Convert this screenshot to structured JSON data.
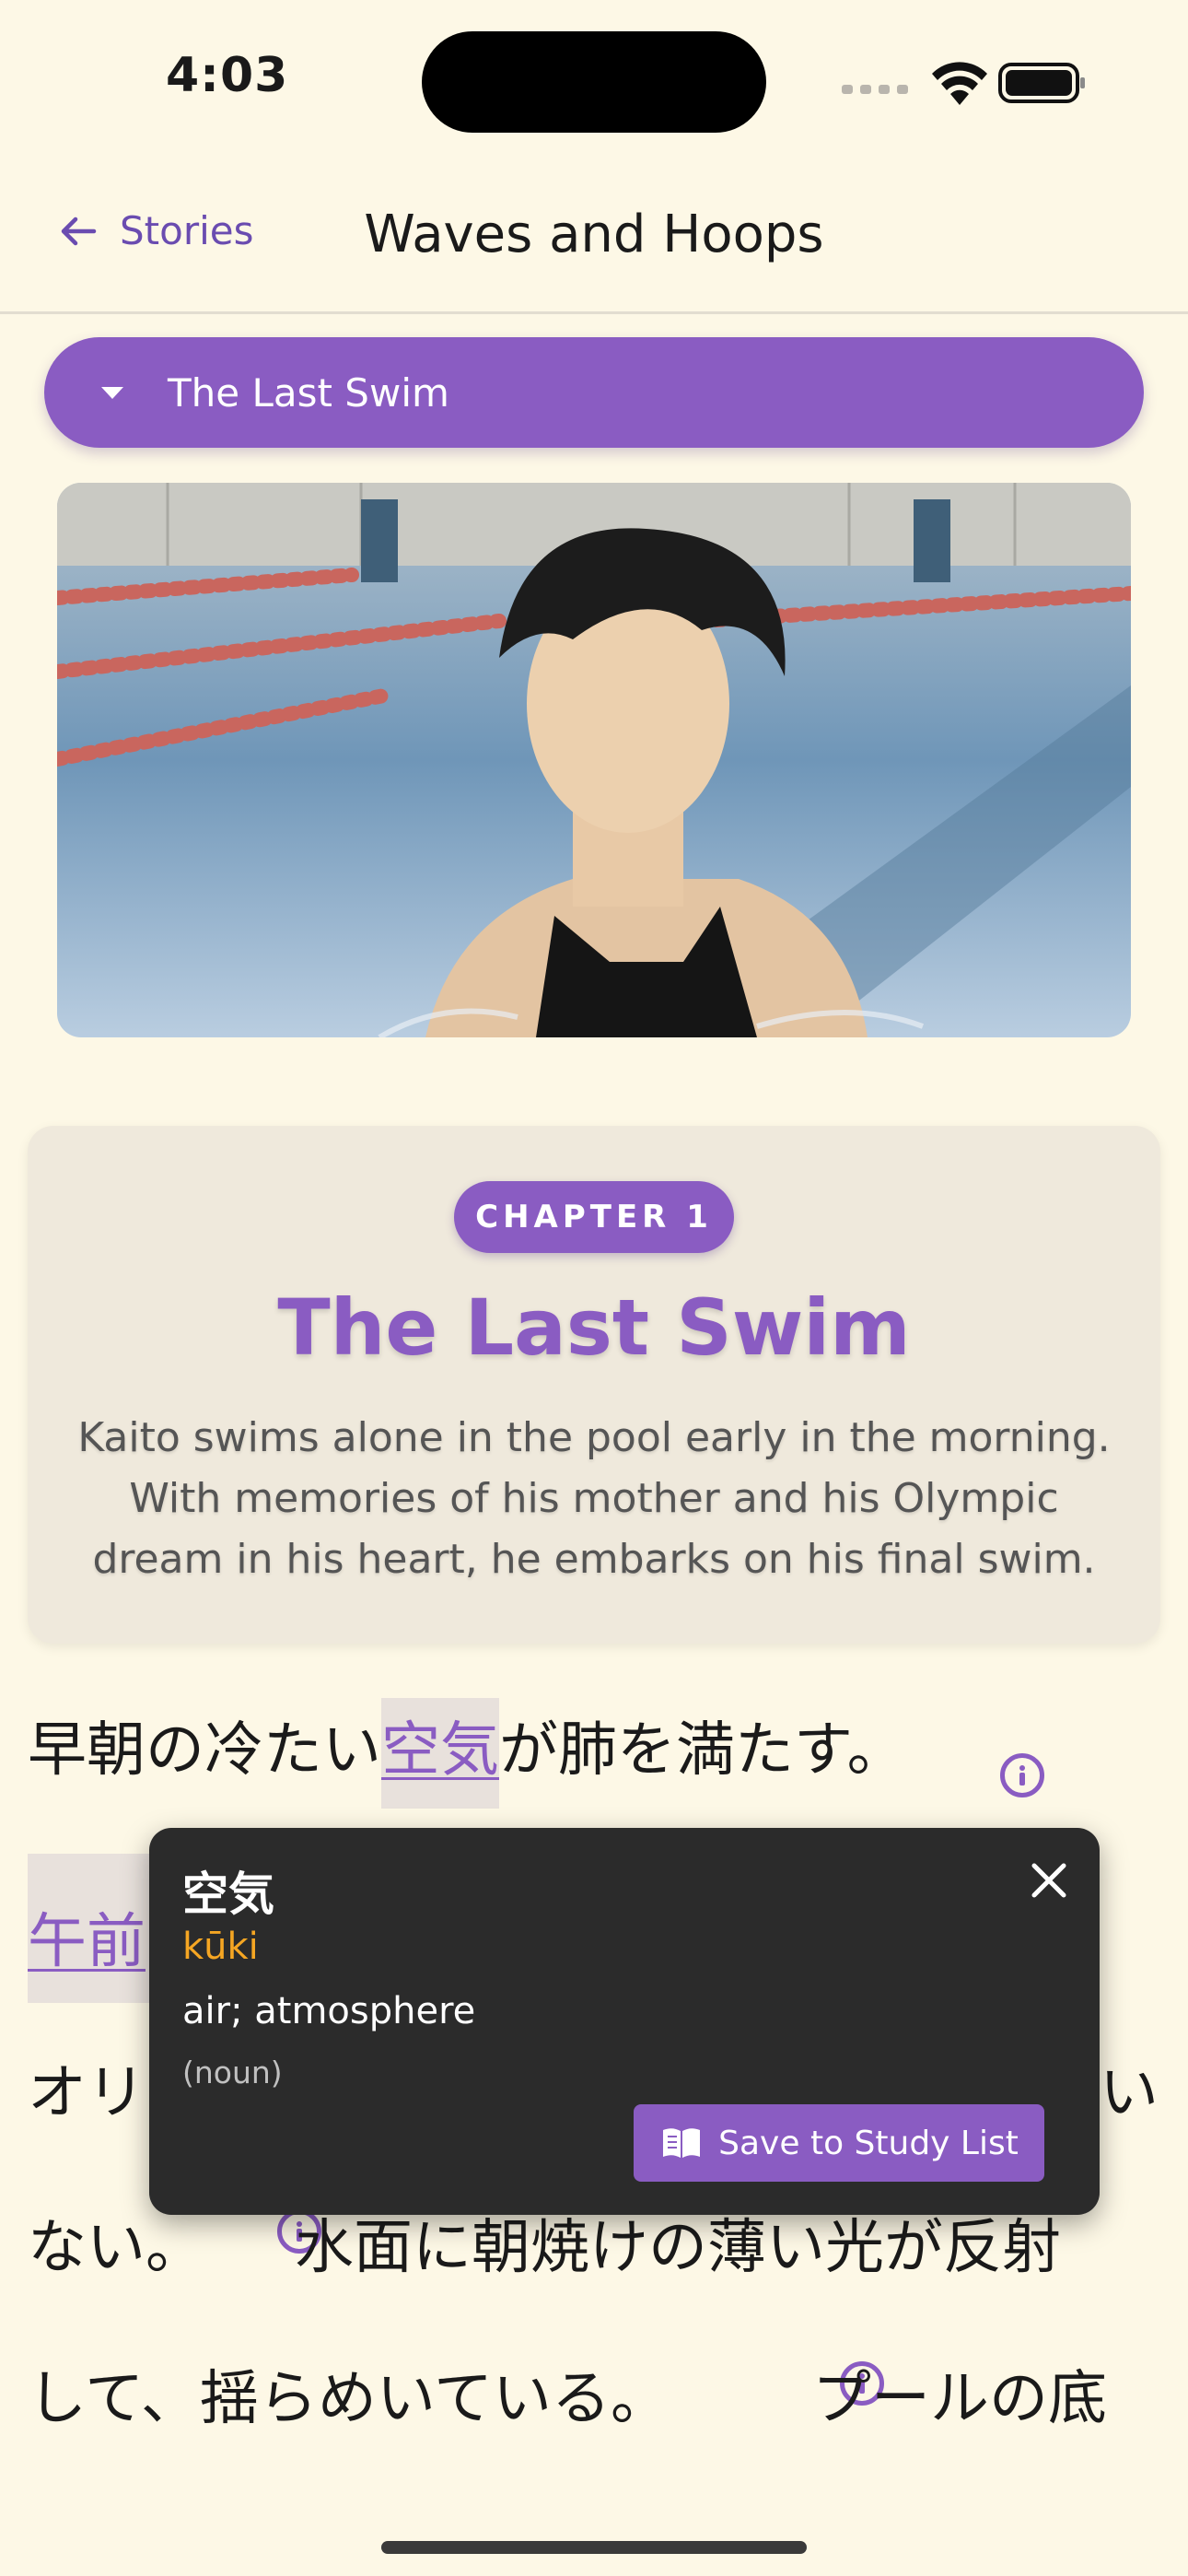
{
  "status_bar": {
    "time": "4:03"
  },
  "nav": {
    "back_label": "Stories",
    "title": "Waves and Hoops"
  },
  "chapter_selector": {
    "selected": "The Last Swim"
  },
  "chapter": {
    "badge": "CHAPTER 1",
    "title": "The Last Swim",
    "description": "Kaito swims alone in the pool early in the morning. With memories of his mother and his Olympic dream in his heart, he embarks on his final swim."
  },
  "text": {
    "line1_a": "早朝の冷たい",
    "line1_word": "空気",
    "line1_b": "が肺を満たす。",
    "line2_word": "午前",
    "line3_start": "オリ",
    "line3_end": "い",
    "line4_a": "ない。",
    "line4_b": "水面に朝焼けの薄い光が反射",
    "line5_a": "して、揺らめいている。",
    "line5_b": "プールの底"
  },
  "popover": {
    "word": "空気",
    "reading": "kūki",
    "meaning": "air; atmosphere",
    "part_of_speech": "(noun)",
    "save_label": "Save to Study List"
  },
  "colors": {
    "accent": "#8a5cc2",
    "background": "#fdf8e6",
    "reading": "#f5a623"
  }
}
